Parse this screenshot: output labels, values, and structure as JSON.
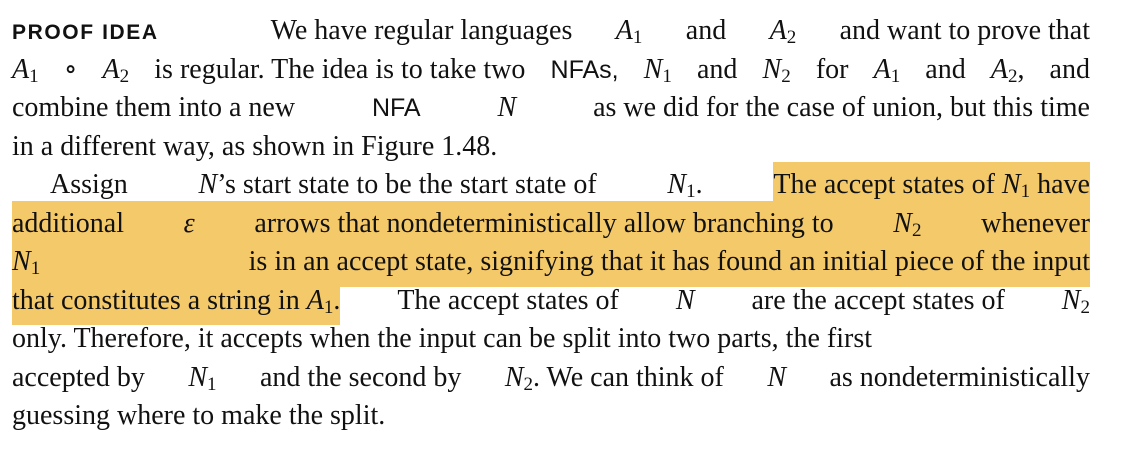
{
  "paragraph1": {
    "label": "PROOF IDEA",
    "line1": {
      "text_a": "We have regular languages",
      "A": "A",
      "one": "1",
      "and": "and",
      "two": "2",
      "tail": "and want to prove that"
    },
    "line2": {
      "A": "A",
      "one": "1",
      "circ": "∘",
      "two": "2",
      "regular": "is regular. The idea is to take two",
      "nfas": "NFAs,",
      "N": "N",
      "and": "and",
      "for": "for",
      "tail": "and"
    },
    "line3": {
      "text_a": "combine them into a new",
      "nfa": "NFA",
      "N": "N",
      "text_b": "as we did for the case of union, but this time"
    },
    "line4": {
      "text": "in a different way, as shown in Figure 1.48."
    }
  },
  "paragraph2": {
    "line1": {
      "assign": "Assign",
      "N": "N",
      "apos_rest": "’s start state to be the start state of",
      "one": "1",
      "period": ".",
      "hl_text": "The accept states of",
      "have": "have"
    },
    "line2": {
      "text_a": "additional",
      "epsilon": "ε",
      "text_b": "arrows that nondeterministically allow branching to",
      "N": "N",
      "two": "2",
      "tail": "whenever"
    },
    "line3": {
      "N": "N",
      "one": "1",
      "text": "is in an accept state, signifying that it has found an initial piece of the input"
    },
    "line4": {
      "hl_text": "that constitutes a string in",
      "A": "A",
      "one": "1",
      "period": ".",
      "text": "The accept states of",
      "N": "N",
      "are": "are the accept states of",
      "two": "2"
    },
    "line5": {
      "text": "only. Therefore, it accepts when the input can be split into two parts, the first"
    },
    "line6": {
      "text_a": "accepted by",
      "N": "N",
      "one": "1",
      "text_b": "and the second by",
      "two": "2",
      "text_c": ". We can think of",
      "text_d": "as nondeterministically"
    },
    "line7": {
      "text": "guessing where to make the split."
    }
  },
  "highlight_color": "#f4c96a"
}
